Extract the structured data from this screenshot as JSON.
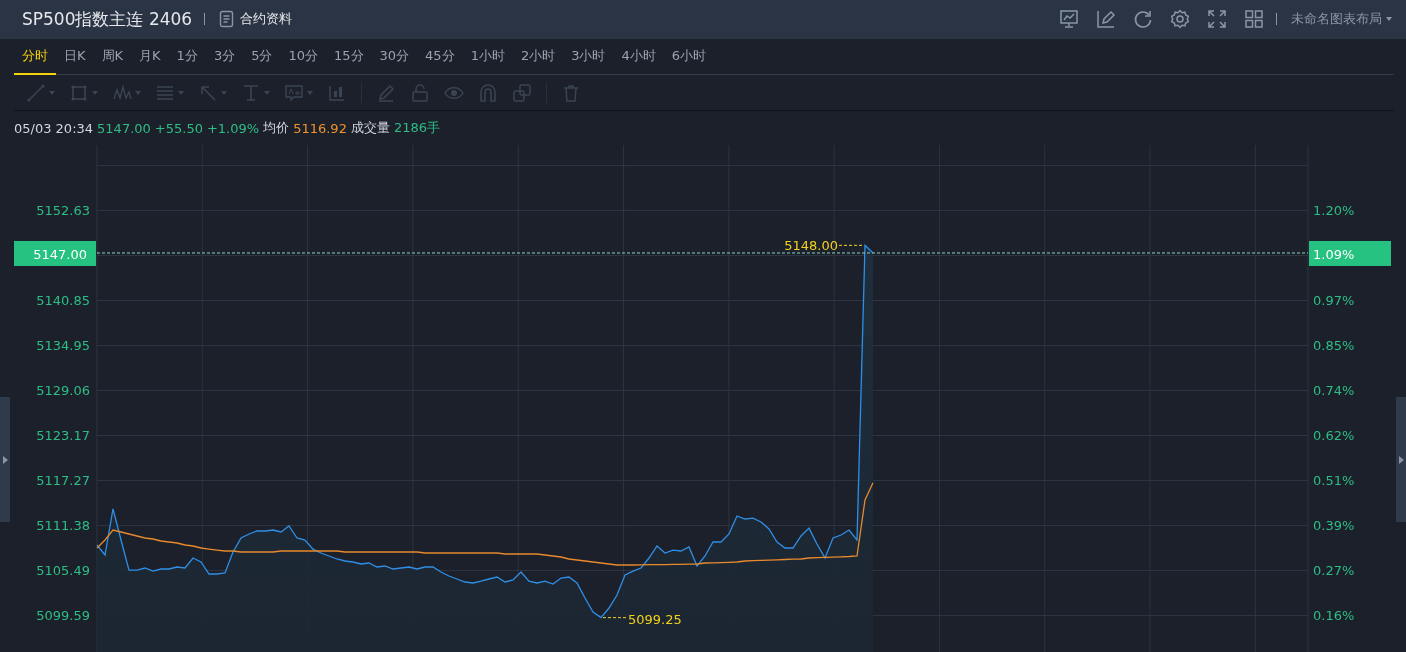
{
  "header": {
    "title": "SP500指数主连 2406",
    "info_link": "合约资料",
    "icons": [
      {
        "kind": "chart-screen"
      },
      {
        "kind": "edit"
      },
      {
        "kind": "refresh"
      },
      {
        "kind": "settings"
      },
      {
        "kind": "fullscreen"
      },
      {
        "kind": "layout-grid"
      }
    ],
    "layout_menu": "未命名图表布局"
  },
  "tabs": [
    {
      "label": "分时",
      "selected": true
    },
    {
      "label": "日K",
      "selected": false
    },
    {
      "label": "周K",
      "selected": false
    },
    {
      "label": "月K",
      "selected": false
    },
    {
      "label": "1分",
      "selected": false
    },
    {
      "label": "3分",
      "selected": false
    },
    {
      "label": "5分",
      "selected": false
    },
    {
      "label": "10分",
      "selected": false
    },
    {
      "label": "15分",
      "selected": false
    },
    {
      "label": "30分",
      "selected": false
    },
    {
      "label": "45分",
      "selected": false
    },
    {
      "label": "1小时",
      "selected": false
    },
    {
      "label": "2小时",
      "selected": false
    },
    {
      "label": "3小时",
      "selected": false
    },
    {
      "label": "4小时",
      "selected": false
    },
    {
      "label": "6小时",
      "selected": false
    }
  ],
  "drawing_tools": [
    {
      "kind": "line",
      "caret": true,
      "disabled": true
    },
    {
      "kind": "rectangle",
      "caret": true,
      "disabled": true
    },
    {
      "kind": "wave",
      "caret": true,
      "disabled": true
    },
    {
      "kind": "levels",
      "caret": true,
      "disabled": true
    },
    {
      "kind": "arrow",
      "caret": true,
      "disabled": true
    },
    {
      "kind": "text",
      "caret": true,
      "disabled": true
    },
    {
      "kind": "label",
      "caret": true,
      "disabled": true
    },
    {
      "kind": "bars",
      "caret": false,
      "disabled": true
    },
    {
      "kind": "separator"
    },
    {
      "kind": "pencil",
      "caret": false,
      "disabled": true
    },
    {
      "kind": "lock",
      "caret": false,
      "disabled": true
    },
    {
      "kind": "eye",
      "caret": false,
      "disabled": true
    },
    {
      "kind": "magnet",
      "caret": false,
      "disabled": true
    },
    {
      "kind": "copy",
      "caret": false,
      "disabled": true
    },
    {
      "kind": "separator"
    },
    {
      "kind": "trash",
      "caret": false,
      "disabled": true
    }
  ],
  "quote_line": [
    {
      "text": "05/03 20:34",
      "color": "#d4d7dc"
    },
    {
      "text": "5147.00",
      "color": "#2ebd85"
    },
    {
      "text": "+55.50",
      "color": "#2ebd85"
    },
    {
      "text": "+1.09%",
      "color": "#2ebd85"
    },
    {
      "text": "均价",
      "color": "#d4d7dc"
    },
    {
      "text": "5116.92",
      "color": "#f0922e"
    },
    {
      "text": "成交量",
      "color": "#d4d7dc"
    },
    {
      "text": "2186手",
      "color": "#2ebd85"
    }
  ],
  "chart": {
    "percent_ticks": [
      "1.20%",
      "0.97%",
      "0.85%",
      "0.74%",
      "0.62%",
      "0.51%",
      "0.39%",
      "0.27%",
      "0.16%"
    ],
    "last_price": {
      "label": "5147.00",
      "percent": "1.09%"
    },
    "extremes": [
      {
        "kind": "high",
        "label": "5148.00"
      },
      {
        "kind": "low",
        "label": "5099.25"
      }
    ],
    "chart_data": {
      "type": "line",
      "grid": true,
      "ylim": [
        5094.75,
        5161.14
      ],
      "yticks": [
        {
          "value": 5152.63,
          "label": "5152.63"
        },
        {
          "value": 5140.85,
          "label": "5140.85"
        },
        {
          "value": 5134.95,
          "label": "5134.95"
        },
        {
          "value": 5129.06,
          "label": "5129.06"
        },
        {
          "value": 5123.17,
          "label": "5123.17"
        },
        {
          "value": 5117.27,
          "label": "5117.27"
        },
        {
          "value": 5111.38,
          "label": "5111.38"
        },
        {
          "value": 5105.49,
          "label": "5105.49"
        },
        {
          "value": 5099.59,
          "label": "5099.59"
        }
      ],
      "categories": [
        null,
        null,
        null,
        null,
        null,
        null,
        null,
        null,
        null,
        null,
        null,
        null,
        null,
        null,
        null,
        null,
        null,
        null,
        null,
        null,
        null,
        null,
        null,
        null,
        null,
        null,
        null,
        null,
        null,
        null,
        null,
        null,
        null,
        null,
        null,
        null,
        null,
        null,
        null,
        null,
        null,
        null,
        null,
        null,
        null,
        null,
        null,
        null,
        null,
        null,
        null,
        null,
        null,
        null,
        null,
        null,
        null,
        null,
        null,
        null,
        null,
        null,
        null,
        null,
        null,
        null,
        null,
        null,
        null,
        null,
        null,
        null,
        null,
        null,
        null,
        null,
        null,
        null,
        null,
        null,
        null,
        null,
        null,
        null,
        null,
        null,
        null,
        null,
        null,
        null,
        null,
        null,
        null,
        null,
        null,
        null,
        null,
        null
      ],
      "series": [
        {
          "type": "area",
          "color": "#2f8fe6",
          "values": [
            5108.76,
            5107.45,
            5113.5,
            5109.41,
            5105.48,
            5105.48,
            5105.75,
            5105.35,
            5105.62,
            5105.62,
            5105.88,
            5105.75,
            5107.06,
            5106.53,
            5104.96,
            5104.96,
            5105.09,
            5107.84,
            5109.68,
            5110.2,
            5110.59,
            5110.59,
            5110.72,
            5110.46,
            5111.25,
            5109.68,
            5109.41,
            5108.23,
            5107.71,
            5107.32,
            5106.93,
            5106.66,
            5106.53,
            5106.27,
            5106.4,
            5105.88,
            5106.01,
            5105.62,
            5105.75,
            5105.88,
            5105.62,
            5105.88,
            5105.88,
            5105.22,
            5104.7,
            5104.31,
            5103.91,
            5103.78,
            5104.04,
            5104.31,
            5104.57,
            5103.91,
            5104.18,
            5105.22,
            5104.04,
            5103.78,
            5104.04,
            5103.65,
            5104.44,
            5104.57,
            5103.78,
            5101.82,
            5099.98,
            5099.25,
            5100.51,
            5102.21,
            5104.83,
            5105.35,
            5105.75,
            5107.06,
            5108.63,
            5107.71,
            5108.1,
            5107.97,
            5108.5,
            5106.01,
            5107.32,
            5109.15,
            5109.15,
            5110.2,
            5112.56,
            5112.16,
            5112.29,
            5111.77,
            5110.85,
            5109.15,
            5108.37,
            5108.37,
            5109.94,
            5110.98,
            5108.89,
            5107.06,
            5109.68,
            5110.07,
            5110.72,
            5109.41,
            5148.0,
            5147.0
          ]
        },
        {
          "type": "line",
          "color": "#e8892c",
          "values": [
            5108.37,
            5109.41,
            5110.72,
            5110.46,
            5110.2,
            5109.94,
            5109.68,
            5109.55,
            5109.28,
            5109.15,
            5109.02,
            5108.76,
            5108.63,
            5108.37,
            5108.23,
            5108.1,
            5107.97,
            5107.97,
            5107.84,
            5107.84,
            5107.84,
            5107.84,
            5107.84,
            5107.97,
            5107.97,
            5107.97,
            5107.97,
            5107.97,
            5107.97,
            5107.97,
            5107.97,
            5107.84,
            5107.84,
            5107.84,
            5107.84,
            5107.84,
            5107.84,
            5107.84,
            5107.84,
            5107.84,
            5107.84,
            5107.71,
            5107.71,
            5107.71,
            5107.71,
            5107.71,
            5107.71,
            5107.71,
            5107.71,
            5107.71,
            5107.71,
            5107.58,
            5107.58,
            5107.58,
            5107.58,
            5107.58,
            5107.45,
            5107.32,
            5107.19,
            5106.93,
            5106.8,
            5106.66,
            5106.53,
            5106.4,
            5106.27,
            5106.14,
            5106.14,
            5106.14,
            5106.17,
            5106.2,
            5106.2,
            5106.2,
            5106.22,
            5106.24,
            5106.26,
            5106.27,
            5106.4,
            5106.43,
            5106.46,
            5106.5,
            5106.53,
            5106.66,
            5106.7,
            5106.74,
            5106.78,
            5106.82,
            5106.86,
            5106.9,
            5106.93,
            5107.06,
            5107.1,
            5107.14,
            5107.18,
            5107.22,
            5107.26,
            5107.32,
            5114.65,
            5116.92
          ]
        }
      ]
    }
  }
}
